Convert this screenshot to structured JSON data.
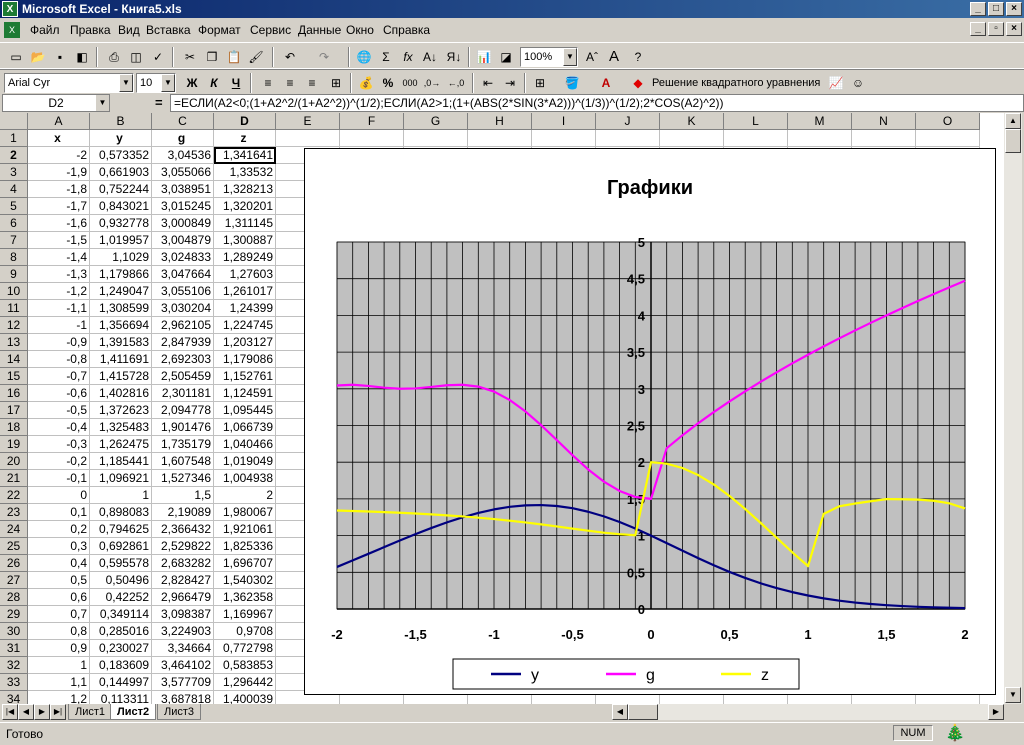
{
  "window": {
    "title": "Microsoft Excel - Книга5.xls",
    "app_icon": "X"
  },
  "menu": [
    "Файл",
    "Правка",
    "Вид",
    "Вставка",
    "Формат",
    "Сервис",
    "Данные",
    "Окно",
    "Справка"
  ],
  "toolbar": {
    "zoom": "100%",
    "font": "Arial Cyr",
    "size": "10",
    "bold": "Ж",
    "italic": "К",
    "underline": "Ч",
    "macro_label": "Решение квадратного уравнения",
    "sum": "Σ",
    "fx": "fx",
    "pct": "%",
    "thousands": "000"
  },
  "formula_bar": {
    "name_box": "D2",
    "eq": "=",
    "formula": "=ЕСЛИ(A2<0;(1+A2^2/(1+A2^2))^(1/2);ЕСЛИ(A2>1;(1+(ABS(2*SIN(3*A2)))^(1/3))^(1/2);2*COS(A2)^2))"
  },
  "columns": [
    "A",
    "B",
    "C",
    "D",
    "E",
    "F",
    "G",
    "H",
    "I",
    "J",
    "K",
    "L",
    "M",
    "N",
    "O"
  ],
  "headers": [
    "x",
    "y",
    "g",
    "z"
  ],
  "rows": [
    [
      "-2",
      "0,573352",
      "3,04536",
      "1,341641"
    ],
    [
      "-1,9",
      "0,661903",
      "3,055066",
      "1,33532"
    ],
    [
      "-1,8",
      "0,752244",
      "3,038951",
      "1,328213"
    ],
    [
      "-1,7",
      "0,843021",
      "3,015245",
      "1,320201"
    ],
    [
      "-1,6",
      "0,932778",
      "3,000849",
      "1,311145"
    ],
    [
      "-1,5",
      "1,019957",
      "3,004879",
      "1,300887"
    ],
    [
      "-1,4",
      "1,1029",
      "3,024833",
      "1,289249"
    ],
    [
      "-1,3",
      "1,179866",
      "3,047664",
      "1,27603"
    ],
    [
      "-1,2",
      "1,249047",
      "3,055106",
      "1,261017"
    ],
    [
      "-1,1",
      "1,308599",
      "3,030204",
      "1,24399"
    ],
    [
      "-1",
      "1,356694",
      "2,962105",
      "1,224745"
    ],
    [
      "-0,9",
      "1,391583",
      "2,847939",
      "1,203127"
    ],
    [
      "-0,8",
      "1,411691",
      "2,692303",
      "1,179086"
    ],
    [
      "-0,7",
      "1,415728",
      "2,505459",
      "1,152761"
    ],
    [
      "-0,6",
      "1,402816",
      "2,301181",
      "1,124591"
    ],
    [
      "-0,5",
      "1,372623",
      "2,094778",
      "1,095445"
    ],
    [
      "-0,4",
      "1,325483",
      "1,901476",
      "1,066739"
    ],
    [
      "-0,3",
      "1,262475",
      "1,735179",
      "1,040466"
    ],
    [
      "-0,2",
      "1,185441",
      "1,607548",
      "1,019049"
    ],
    [
      "-0,1",
      "1,096921",
      "1,527346",
      "1,004938"
    ],
    [
      "0",
      "1",
      "1,5",
      "2"
    ],
    [
      "0,1",
      "0,898083",
      "2,19089",
      "1,980067"
    ],
    [
      "0,2",
      "0,794625",
      "2,366432",
      "1,921061"
    ],
    [
      "0,3",
      "0,692861",
      "2,529822",
      "1,825336"
    ],
    [
      "0,4",
      "0,595578",
      "2,683282",
      "1,696707"
    ],
    [
      "0,5",
      "0,50496",
      "2,828427",
      "1,540302"
    ],
    [
      "0,6",
      "0,42252",
      "2,966479",
      "1,362358"
    ],
    [
      "0,7",
      "0,349114",
      "3,098387",
      "1,169967"
    ],
    [
      "0,8",
      "0,285016",
      "3,224903",
      "0,9708"
    ],
    [
      "0,9",
      "0,230027",
      "3,34664",
      "0,772798"
    ],
    [
      "1",
      "0,183609",
      "3,464102",
      "0,583853"
    ],
    [
      "1,1",
      "0,144997",
      "3,577709",
      "1,296442"
    ],
    [
      "1,2",
      "0,113311",
      "3,687818",
      "1,400039"
    ]
  ],
  "sheets": [
    "Лист1",
    "Лист2",
    "Лист3"
  ],
  "status": {
    "left": "Готово",
    "num": "NUM"
  },
  "colors": {
    "y": "#000080",
    "g": "#ff00ff",
    "z": "#ffff00",
    "plot_bg": "#c0c0c0"
  },
  "chart_data": {
    "type": "line",
    "title": "Графики",
    "xlim": [
      -2,
      2
    ],
    "ylim": [
      0,
      5
    ],
    "x_ticks": [
      "-2",
      "-1,5",
      "-1",
      "-0,5",
      "0",
      "0,5",
      "1",
      "1,5",
      "2"
    ],
    "y_ticks": [
      "0",
      "0,5",
      "1",
      "1,5",
      "2",
      "2,5",
      "3",
      "3,5",
      "4",
      "4,5",
      "5"
    ],
    "legend": "bottom",
    "grid": true,
    "x": [
      -2,
      -1.9,
      -1.8,
      -1.7,
      -1.6,
      -1.5,
      -1.4,
      -1.3,
      -1.2,
      -1.1,
      -1,
      -0.9,
      -0.8,
      -0.7,
      -0.6,
      -0.5,
      -0.4,
      -0.3,
      -0.2,
      -0.1,
      0,
      0.1,
      0.2,
      0.3,
      0.4,
      0.5,
      0.6,
      0.7,
      0.8,
      0.9,
      1,
      1.1,
      1.2,
      1.3,
      1.4,
      1.5,
      1.6,
      1.7,
      1.8,
      1.9,
      2
    ],
    "series": [
      {
        "name": "y",
        "values": [
          0.573,
          0.662,
          0.752,
          0.843,
          0.933,
          1.02,
          1.103,
          1.18,
          1.249,
          1.309,
          1.357,
          1.392,
          1.412,
          1.416,
          1.403,
          1.373,
          1.325,
          1.262,
          1.185,
          1.097,
          1.0,
          0.898,
          0.795,
          0.693,
          0.596,
          0.505,
          0.423,
          0.349,
          0.285,
          0.23,
          0.184,
          0.145,
          0.113,
          0.088,
          0.068,
          0.052,
          0.04,
          0.03,
          0.023,
          0.017,
          0.013
        ]
      },
      {
        "name": "g",
        "values": [
          3.045,
          3.055,
          3.039,
          3.015,
          3.001,
          3.005,
          3.025,
          3.048,
          3.055,
          3.03,
          2.962,
          2.848,
          2.692,
          2.505,
          2.301,
          2.095,
          1.901,
          1.735,
          1.608,
          1.527,
          1.5,
          2.191,
          2.366,
          2.53,
          2.683,
          2.828,
          2.966,
          3.098,
          3.225,
          3.347,
          3.464,
          3.578,
          3.688,
          3.795,
          3.899,
          4.0,
          4.099,
          4.196,
          4.29,
          4.382,
          4.472
        ]
      },
      {
        "name": "z",
        "values": [
          1.342,
          1.335,
          1.328,
          1.32,
          1.311,
          1.301,
          1.289,
          1.276,
          1.261,
          1.244,
          1.225,
          1.203,
          1.179,
          1.153,
          1.125,
          1.095,
          1.067,
          1.04,
          1.019,
          1.005,
          2.0,
          1.98,
          1.921,
          1.825,
          1.697,
          1.54,
          1.362,
          1.17,
          0.971,
          0.773,
          0.584,
          1.296,
          1.4,
          1.437,
          1.468,
          1.497,
          1.495,
          1.49,
          1.475,
          1.44,
          1.37
        ]
      }
    ]
  }
}
